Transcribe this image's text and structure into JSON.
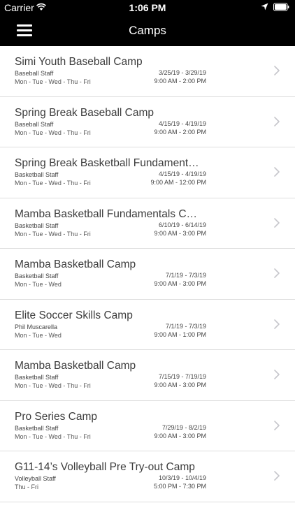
{
  "status_bar": {
    "carrier": "Carrier",
    "time": "1:06 PM",
    "wifi_icon": "wifi-icon",
    "location_icon": "location-arrow-icon",
    "battery_icon": "battery-full-icon"
  },
  "nav": {
    "title": "Camps",
    "menu_icon": "hamburger-menu-icon"
  },
  "colors": {
    "bar_background": "#000000",
    "bar_text": "#ffffff",
    "separator": "#dddddd",
    "chevron": "#c7c7cc"
  },
  "camps": [
    {
      "name": "Simi Youth Baseball Camp",
      "staff": "Baseball Staff",
      "days": "Mon - Tue - Wed - Thu - Fri",
      "dates": "3/25/19 - 3/29/19",
      "times": "9:00 AM - 2:00 PM"
    },
    {
      "name": "Spring Break Baseball Camp",
      "staff": "Baseball Staff",
      "days": "Mon - Tue - Wed - Thu - Fri",
      "dates": "4/15/19 - 4/19/19",
      "times": "9:00 AM - 2:00 PM"
    },
    {
      "name": "Spring Break Basketball Fundament…",
      "staff": "Basketball Staff",
      "days": "Mon - Tue - Wed - Thu - Fri",
      "dates": "4/15/19 - 4/19/19",
      "times": "9:00 AM - 12:00 PM"
    },
    {
      "name": "Mamba Basketball Fundamentals C…",
      "staff": "Basketball Staff",
      "days": "Mon - Tue - Wed - Thu - Fri",
      "dates": "6/10/19 - 6/14/19",
      "times": "9:00 AM - 3:00 PM"
    },
    {
      "name": "Mamba Basketball Camp",
      "staff": "Basketball Staff",
      "days": "Mon - Tue - Wed",
      "dates": "7/1/19 - 7/3/19",
      "times": "9:00 AM - 3:00 PM"
    },
    {
      "name": "Elite Soccer Skills Camp",
      "staff": "Phil Muscarella",
      "days": "Mon - Tue - Wed",
      "dates": "7/1/19 - 7/3/19",
      "times": "9:00 AM - 1:00 PM"
    },
    {
      "name": "Mamba Basketball Camp",
      "staff": "Basketball Staff",
      "days": "Mon - Tue - Wed - Thu - Fri",
      "dates": "7/15/19 - 7/19/19",
      "times": "9:00 AM - 3:00 PM"
    },
    {
      "name": "Pro Series Camp",
      "staff": "Basketball Staff",
      "days": "Mon - Tue - Wed - Thu - Fri",
      "dates": "7/29/19 - 8/2/19",
      "times": "9:00 AM - 3:00 PM"
    },
    {
      "name": "G11-14’s Volleyball Pre Try-out Camp",
      "staff": "Volleyball Staff",
      "days": "Thu - Fri",
      "dates": "10/3/19 - 10/4/19",
      "times": "5:00 PM - 7:30 PM"
    }
  ]
}
